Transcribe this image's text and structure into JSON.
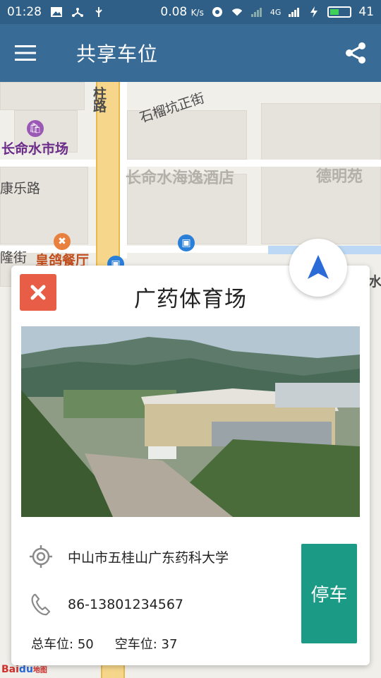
{
  "status_bar": {
    "time": "01:28",
    "speed": "0.08",
    "speed_unit": "K/s",
    "network": "4G",
    "battery": "41"
  },
  "app_bar": {
    "title": "共享车位",
    "menu_icon": "hamburger-menu-icon",
    "share_icon": "share-icon"
  },
  "map": {
    "labels": {
      "market": "长命水市场",
      "road_top": "路",
      "road_top2": "柱",
      "street1": "石榴坑正街",
      "hotel": "长命水海逸酒店",
      "demingyuan": "德明苑",
      "kangle": "康乐路",
      "restaurant": "皇鸽餐厅",
      "street_left": "隆街",
      "edge_right": "水"
    },
    "attribution_red": "Bai",
    "attribution_blue": "du",
    "attribution_tail": "地图"
  },
  "card": {
    "title": "广药体育场",
    "address": "中山市五桂山广东药科大学",
    "phone": "86-13801234567",
    "total_label": "总车位:",
    "total_value": "50",
    "free_label": "空车位:",
    "free_value": "37",
    "park_button": "停车"
  },
  "colors": {
    "appbar": "#386b96",
    "close_button": "#e85d45",
    "park_button": "#1b9b85",
    "nav_arrow": "#2a6bd8"
  }
}
